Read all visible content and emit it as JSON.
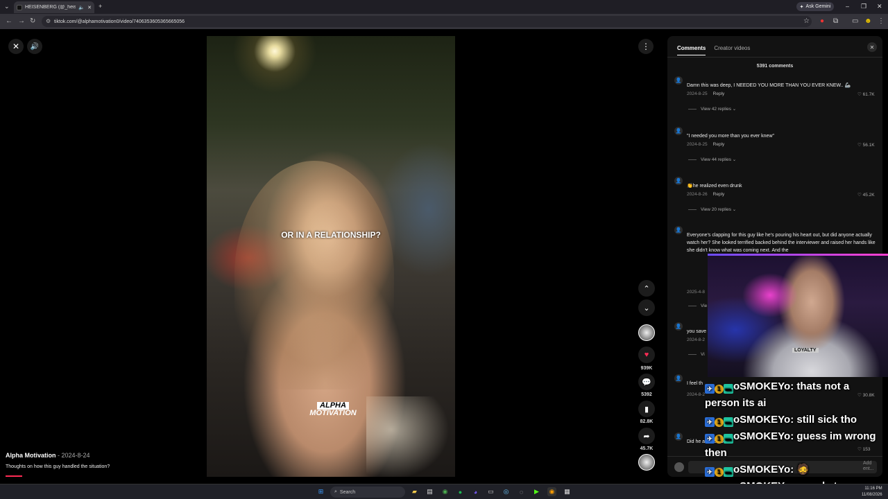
{
  "browser": {
    "tab_title": "HEISENBERG (@_heisenb...",
    "url": "tiktok.com/@alphamotivation0/video/7406353605365665056",
    "ask_gemini": "Ask Gemini"
  },
  "video": {
    "caption": "OR IN A RELATIONSHIP?",
    "watermark_line1": "ALPHA",
    "watermark_line2": "MOTIVATION",
    "author": "Alpha Motivation",
    "date": "2024-8-24",
    "description": "Thoughts on how this guy handled the situation?",
    "likes": "939K",
    "comments": "5392",
    "saves": "82.8K",
    "shares": "45.7K"
  },
  "panel": {
    "tab_comments": "Comments",
    "tab_creator": "Creator videos",
    "count": "5391 comments",
    "comments": [
      {
        "text": "Damn this was deep, I NEEDED YOU MORE THAN YOU EVER KNEW.. 🦾",
        "date": "2024-8-25",
        "reply": "Reply",
        "likes": "61.7K",
        "replies": "View 42 replies ⌄"
      },
      {
        "text": "\"I needed you more than you ever knew\"",
        "date": "2024-8-25",
        "reply": "Reply",
        "likes": "56.1K",
        "replies": "View 44 replies ⌄"
      },
      {
        "text": "👏he realized even drunk",
        "date": "2024-8-26",
        "reply": "Reply",
        "likes": "45.2K",
        "replies": "View 20 replies ⌄"
      },
      {
        "text": "Everyone's clapping for this guy like he's pouring his heart out, but did anyone actually watch her? She looked terrified backed behind the interviewer and raised her hands like she didn't know what was coming next. And the",
        "date": "2025-4-8",
        "reply": "",
        "likes": "",
        "replies": "Vie"
      },
      {
        "text": "you save",
        "date": "2024-8-2",
        "reply": "",
        "likes": "",
        "replies": "Vi"
      },
      {
        "text": "I feel th",
        "date": "2024-8-2",
        "reply": "",
        "likes": "30.8K",
        "replies": ""
      },
      {
        "text": "Did he ask her to be",
        "date": "",
        "reply": "",
        "likes": "153",
        "replies": ""
      }
    ],
    "add_comment_placeholder": "Add ent..."
  },
  "chat": [
    {
      "user": "oSMOKEYo:",
      "msg": " thats not a",
      "cont": "person its ai"
    },
    {
      "user": "oSMOKEYo:",
      "msg": " still sick tho",
      "cont": ""
    },
    {
      "user": "oSMOKEYo:",
      "msg": " guess im wrong",
      "cont": "then"
    },
    {
      "user": "oSMOKEYo:",
      "msg": " 🧔",
      "cont": ""
    },
    {
      "user": "oSMOKEYo:",
      "msg": " google tas",
      "cont": ""
    }
  ],
  "webcam": {
    "shirt_text": "LOYALTY"
  },
  "taskbar": {
    "search": "Search",
    "time": "11:16 PM",
    "date": "11/08/2026"
  }
}
